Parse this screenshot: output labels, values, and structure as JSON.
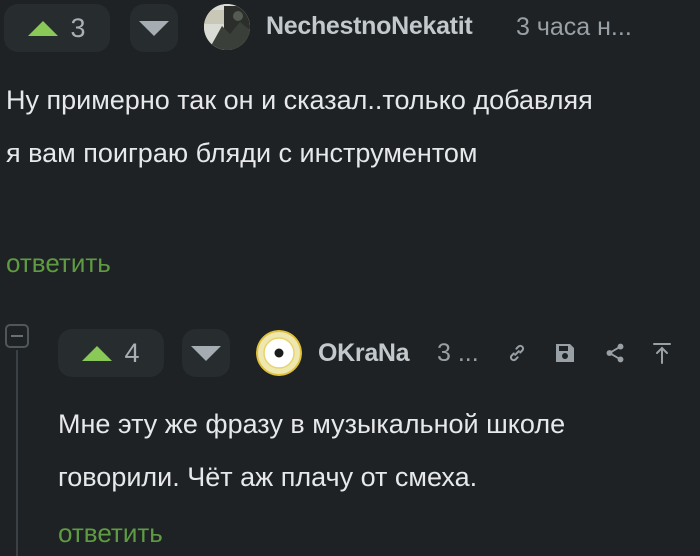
{
  "comment1": {
    "rating": "3",
    "author": "NechestnoNekatit",
    "time": "3 часа н...",
    "text": "Ну примерно так он и сказал..только добавляя я вам поиграю бляди с инструментом",
    "reply_label": "ответить"
  },
  "comment2": {
    "rating": "4",
    "author": "OKraNa",
    "time": "3 ...",
    "text": "Мне эту же фразу в музыкальной школе говорили. Чёт аж плачу от смеха.",
    "reply_label": "ответить"
  },
  "colors": {
    "background": "#1e2224",
    "upvote": "#8ac858",
    "reply_link": "#5e9b42",
    "muted": "#9aa1a6"
  },
  "icons": {
    "comment2_actions": [
      "link-icon",
      "save-icon",
      "share-icon",
      "scroll-to-top-icon"
    ]
  }
}
